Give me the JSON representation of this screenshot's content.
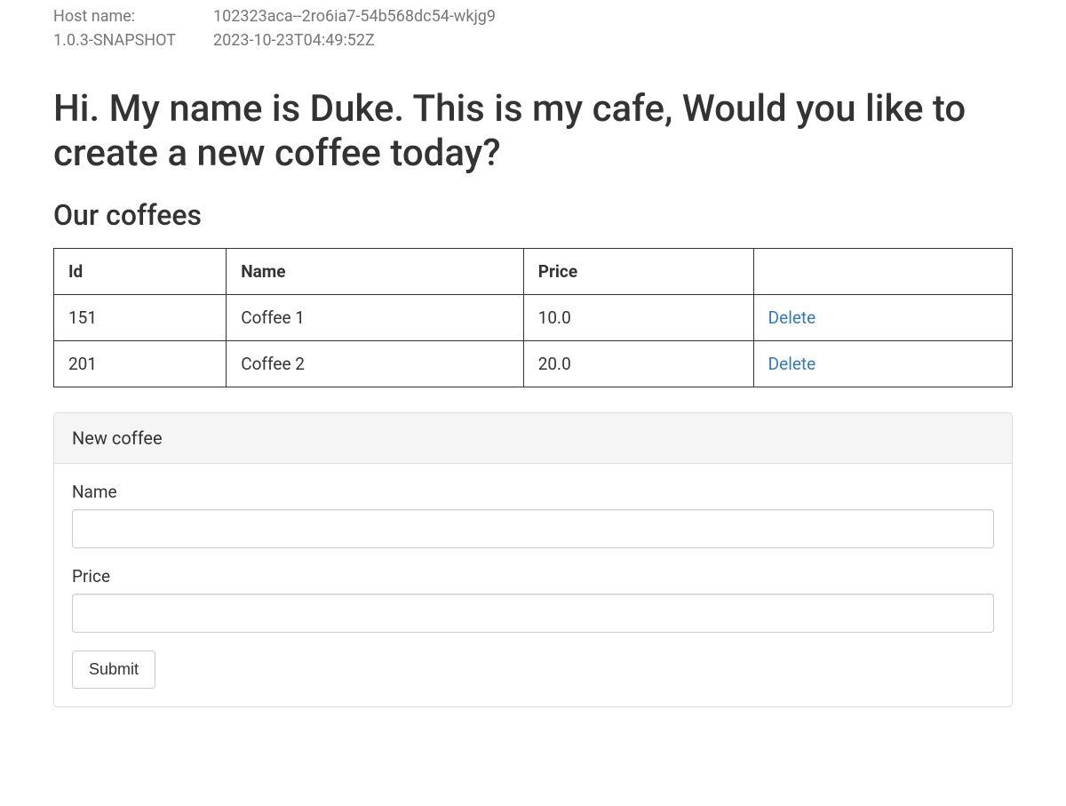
{
  "header": {
    "host_label": "Host name:",
    "host_value": "102323aca--2ro6ia7-54b568dc54-wkjg9",
    "version_label": "1.0.3-SNAPSHOT",
    "timestamp": "2023-10-23T04:49:52Z"
  },
  "page_title": "Hi. My name is Duke. This is my cafe, Would you like to create a new coffee today?",
  "section_title": "Our coffees",
  "table": {
    "columns": {
      "id": "Id",
      "name": "Name",
      "price": "Price",
      "action": ""
    },
    "rows": [
      {
        "id": "151",
        "name": "Coffee 1",
        "price": "10.0",
        "action": "Delete"
      },
      {
        "id": "201",
        "name": "Coffee 2",
        "price": "20.0",
        "action": "Delete"
      }
    ]
  },
  "form": {
    "panel_title": "New coffee",
    "name_label": "Name",
    "name_value": "",
    "price_label": "Price",
    "price_value": "",
    "submit_label": "Submit"
  }
}
